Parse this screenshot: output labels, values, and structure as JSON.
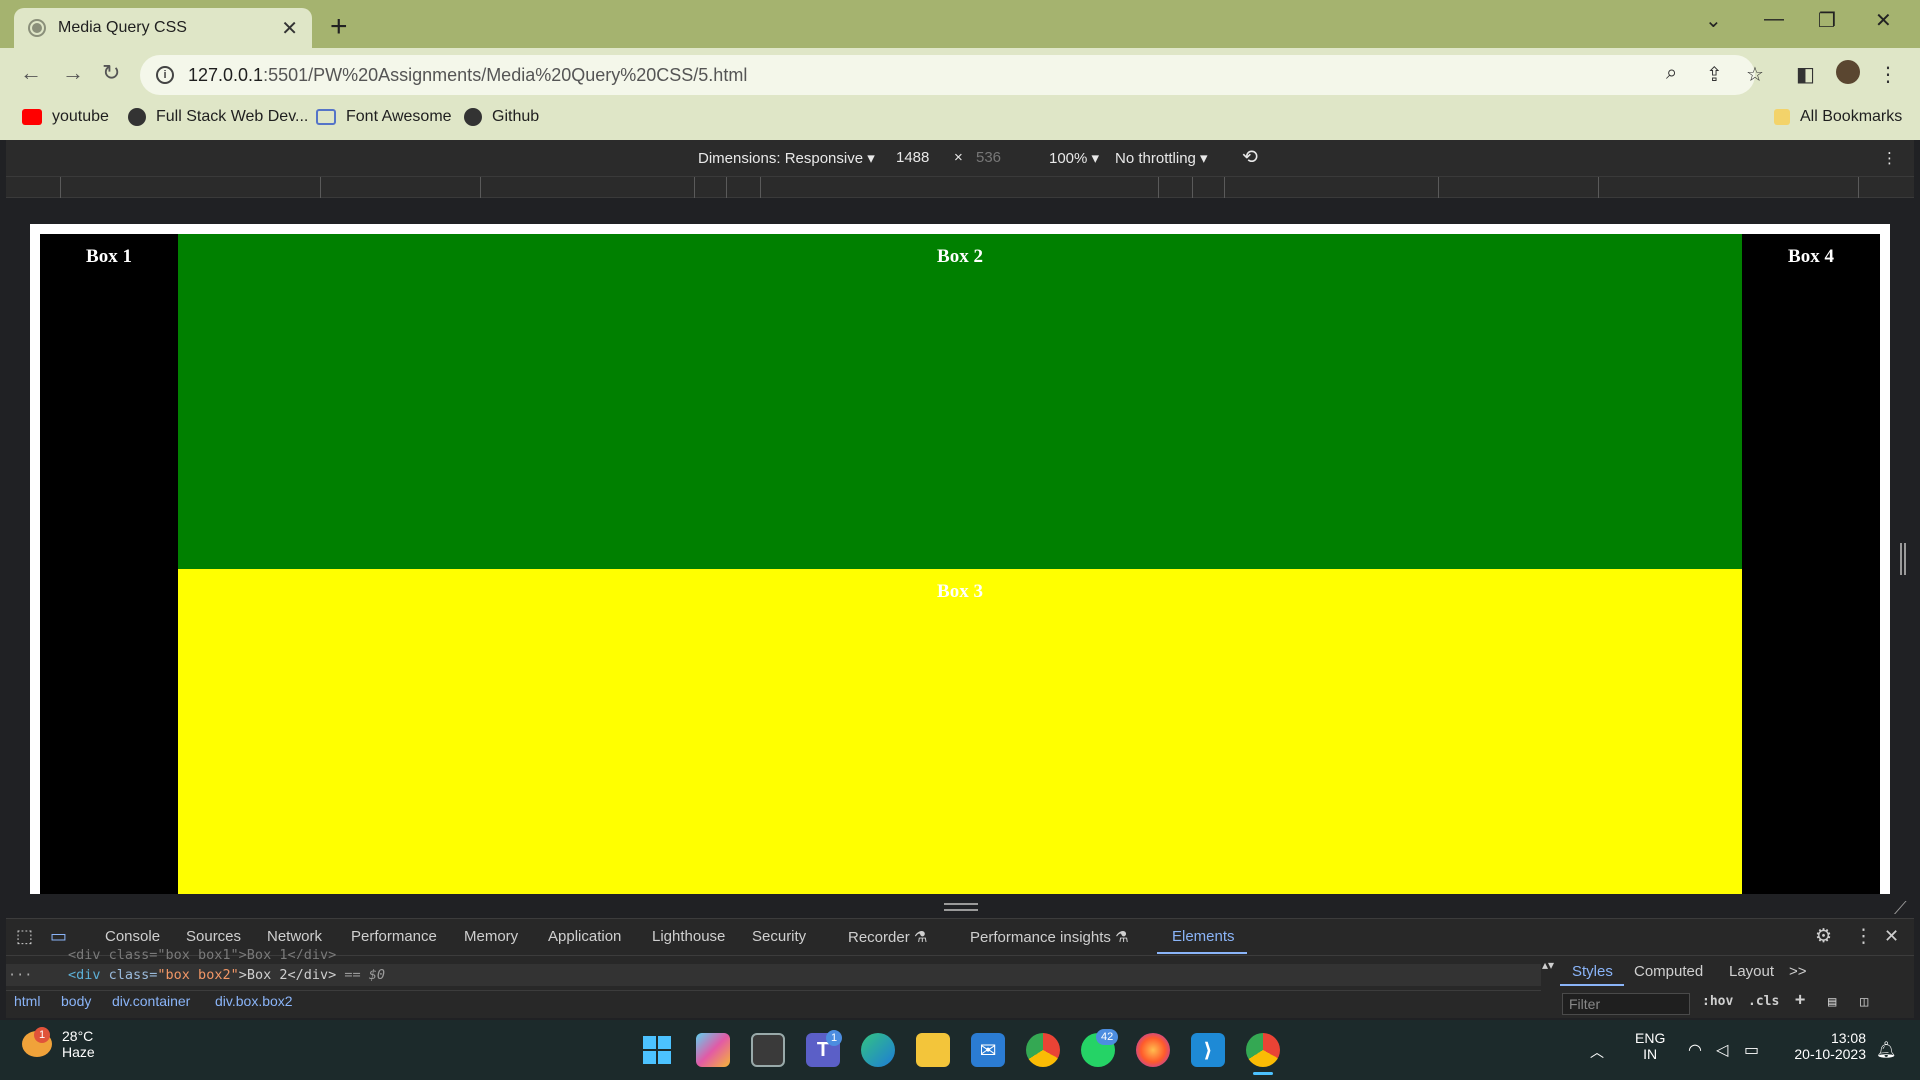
{
  "browser": {
    "tab_title": "Media Query CSS",
    "tab_close": "✕",
    "new_tab": "+",
    "url_host": "127.0.0.1",
    "url_rest": ":5501/PW%20Assignments/Media%20Query%20CSS/5.html",
    "bookmarks": [
      {
        "label": "youtube",
        "color": "#ff0000"
      },
      {
        "label": "Full Stack Web Dev...",
        "color": "#333333"
      },
      {
        "label": "Font Awesome",
        "color": "#5574c8"
      },
      {
        "label": "Github",
        "color": "#333333"
      }
    ],
    "all_bookmarks": "All Bookmarks"
  },
  "device_toolbar": {
    "dimensions": "Dimensions: Responsive ▾",
    "width": "1488",
    "times": "×",
    "height": "536",
    "zoom": "100% ▾",
    "throttling": "No throttling ▾"
  },
  "page": {
    "box1": "Box 1",
    "box2": "Box 2",
    "box3": "Box 3",
    "box4": "Box 4",
    "colors": {
      "box1": "#000000",
      "box2": "#008000",
      "box3": "#ffff00",
      "box4": "#000000"
    }
  },
  "devtools": {
    "tabs": [
      "Console",
      "Sources",
      "Network",
      "Performance",
      "Memory",
      "Application",
      "Lighthouse",
      "Security",
      "Recorder ⚗",
      "Performance insights ⚗",
      "Elements"
    ],
    "active_tab": "Elements",
    "code_line_prev": "<div class=\"box box1\">Box 1</div>",
    "code_open": "<div ",
    "code_attr": "class=",
    "code_val": "\"box box2\"",
    "code_text": ">Box 2</div>",
    "code_sel": " == $0",
    "code_dots": "···",
    "breadcrumbs": [
      "html",
      "body",
      "div.container",
      "div.box.box2"
    ],
    "side_tabs": [
      "Styles",
      "Computed",
      "Layout",
      ">>"
    ],
    "filter_placeholder": "Filter",
    "hov": ":hov",
    "cls": ".cls"
  },
  "taskbar": {
    "weather_temp": "28°C",
    "weather_desc": "Haze",
    "weather_badge": "1",
    "teams_badge": "1",
    "whatsapp_badge": "42",
    "lang1": "ENG",
    "lang2": "IN",
    "time": "13:08",
    "date": "20-10-2023"
  }
}
